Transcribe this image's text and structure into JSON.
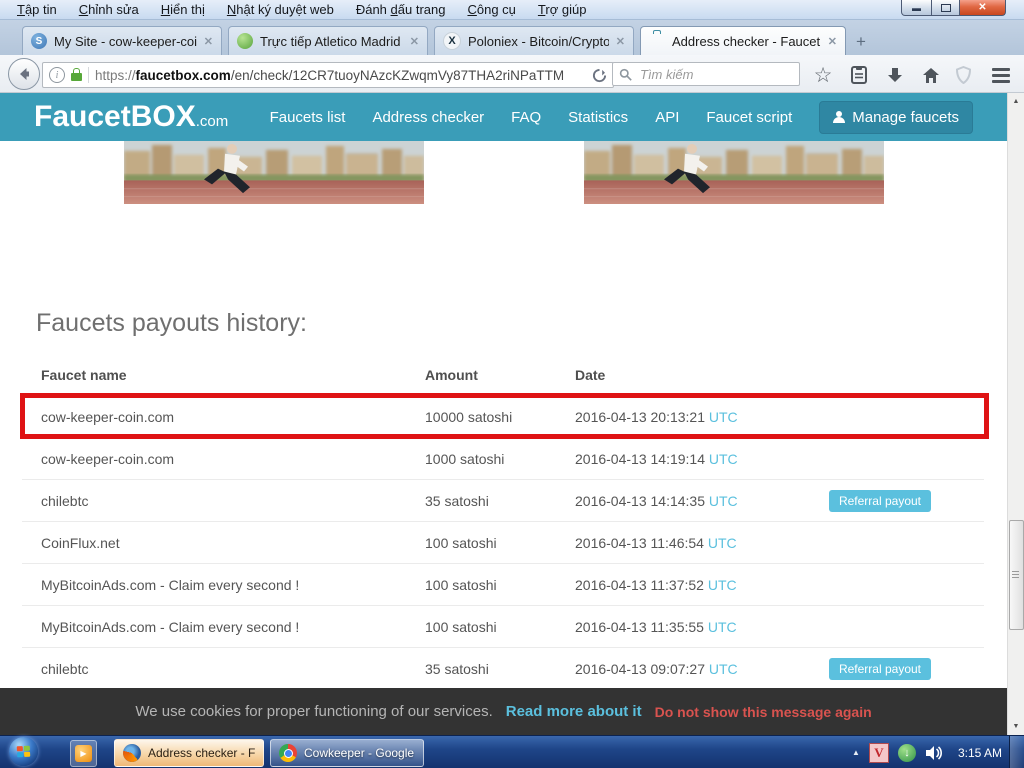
{
  "browser": {
    "menu_items": [
      {
        "label": "Tập tin",
        "accel": 0
      },
      {
        "label": "Chỉnh sửa",
        "accel": 0
      },
      {
        "label": "Hiển thị",
        "accel": 0
      },
      {
        "label": "Nhật ký duyệt web",
        "accel": 0
      },
      {
        "label": "Đánh dấu trang",
        "accel": 5
      },
      {
        "label": "Công cụ",
        "accel": 0
      },
      {
        "label": "Trợ giúp",
        "accel": 0
      }
    ],
    "tabs": [
      {
        "title": "My Site - cow-keeper-coin...."
      },
      {
        "title": "Trực tiếp Atletico Madrid v..."
      },
      {
        "title": "Poloniex - Bitcoin/Cryptoc..."
      },
      {
        "title": "Address checker - FaucetB..."
      }
    ],
    "tab3_glyph": "X",
    "url_protocol": "https://",
    "url_domain": "faucetbox.com",
    "url_path": "/en/check/12CR7tuoyNAzcKZwqmVy87THA2riNPaTTM",
    "search_placeholder": "Tìm kiếm"
  },
  "site": {
    "logo": "FaucetBOX",
    "logo_suffix": ".com",
    "nav": [
      "Faucets list",
      "Address checker",
      "FAQ",
      "Statistics",
      "API",
      "Faucet script"
    ],
    "manage_button": "Manage faucets"
  },
  "payouts": {
    "heading": "Faucets payouts history:",
    "columns": {
      "name": "Faucet name",
      "amount": "Amount",
      "date": "Date"
    },
    "utc_label": "UTC",
    "badge_label": "Referral payout",
    "rows": [
      {
        "name": "cow-keeper-coin.com",
        "amount": "10000 satoshi",
        "date": "2016-04-13 20:13:21"
      },
      {
        "name": "cow-keeper-coin.com",
        "amount": "1000 satoshi",
        "date": "2016-04-13 14:19:14"
      },
      {
        "name": "chilebtc",
        "amount": "35 satoshi",
        "date": "2016-04-13 14:14:35"
      },
      {
        "name": "CoinFlux.net",
        "amount": "100 satoshi",
        "date": "2016-04-13 11:46:54"
      },
      {
        "name": "MyBitcoinAds.com - Claim every second !",
        "amount": "100 satoshi",
        "date": "2016-04-13 11:37:52"
      },
      {
        "name": "MyBitcoinAds.com - Claim every second !",
        "amount": "100 satoshi",
        "date": "2016-04-13 11:35:55"
      },
      {
        "name": "chilebtc",
        "amount": "35 satoshi",
        "date": "2016-04-13 09:07:27"
      }
    ]
  },
  "cookie_bar": {
    "message": "We use cookies for proper functioning of our services.",
    "read_more": "Read more about it",
    "dismiss": "Do not show this message again"
  },
  "taskbar": {
    "firefox_button": "Address checker - Fa...",
    "chrome_button": "Cowkeeper - Google ...",
    "clock": "3:15 AM"
  },
  "colors": {
    "accent_teal": "#3a9db8",
    "link_blue": "#5bc0de",
    "highlight_red": "#df1314",
    "dismiss_red": "#d9534f"
  }
}
